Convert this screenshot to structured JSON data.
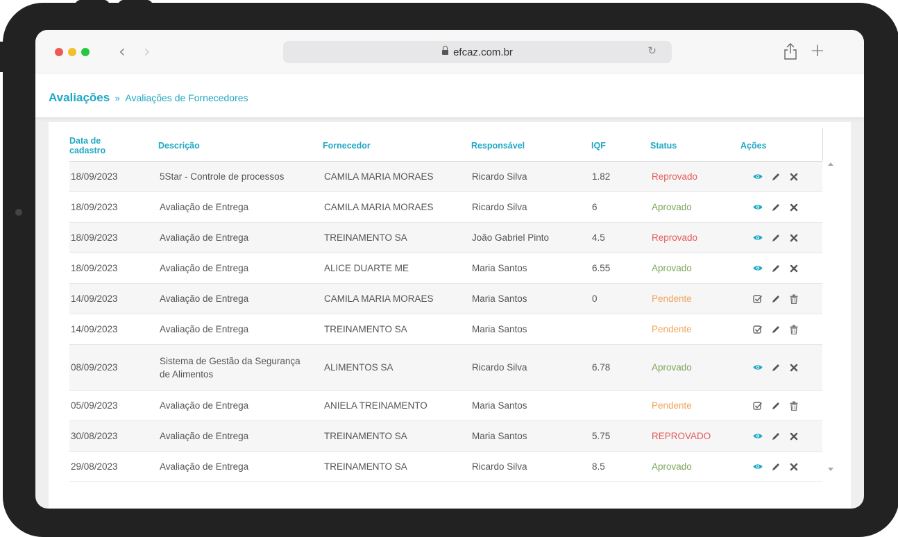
{
  "browser": {
    "url": "efcaz.com.br",
    "back_glyph": "‹",
    "forward_glyph": "›",
    "reload_glyph": "↻",
    "new_tab_glyph": "+"
  },
  "breadcrumb": {
    "main": "Avaliações",
    "separator": "»",
    "sub": "Avaliações de Fornecedores"
  },
  "table": {
    "headers": {
      "date": "Data de cadastro",
      "description": "Descrição",
      "supplier": "Fornecedor",
      "responsible": "Responsável",
      "iqf": "IQF",
      "status": "Status",
      "actions": "Ações"
    },
    "rows": [
      {
        "date": "18/09/2023",
        "description": "5Star - Controle de processos",
        "supplier": "CAMILA MARIA MORAES",
        "responsible": "Ricardo Silva",
        "iqf": "1.82",
        "status": "Reprovado",
        "status_kind": "reprovado",
        "actions": [
          "view",
          "edit",
          "delete-x"
        ]
      },
      {
        "date": "18/09/2023",
        "description": "Avaliação de Entrega",
        "supplier": "CAMILA MARIA MORAES",
        "responsible": "Ricardo Silva",
        "iqf": "6",
        "status": "Aprovado",
        "status_kind": "aprovado",
        "actions": [
          "view",
          "edit",
          "delete-x"
        ]
      },
      {
        "date": "18/09/2023",
        "description": "Avaliação de Entrega",
        "supplier": "TREINAMENTO SA",
        "responsible": "João Gabriel Pinto",
        "iqf": "4.5",
        "status": "Reprovado",
        "status_kind": "reprovado",
        "actions": [
          "view",
          "edit",
          "delete-x"
        ]
      },
      {
        "date": "18/09/2023",
        "description": "Avaliação de Entrega",
        "supplier": "ALICE DUARTE ME",
        "responsible": "Maria Santos",
        "iqf": "6.55",
        "status": "Aprovado",
        "status_kind": "aprovado",
        "actions": [
          "view",
          "edit",
          "delete-x"
        ]
      },
      {
        "date": "14/09/2023",
        "description": "Avaliação de Entrega",
        "supplier": "CAMILA MARIA MORAES",
        "responsible": "Maria Santos",
        "iqf": "0",
        "status": "Pendente",
        "status_kind": "pendente",
        "actions": [
          "evaluate",
          "edit",
          "trash"
        ]
      },
      {
        "date": "14/09/2023",
        "description": "Avaliação de Entrega",
        "supplier": "TREINAMENTO SA",
        "responsible": "Maria Santos",
        "iqf": "",
        "status": "Pendente",
        "status_kind": "pendente",
        "actions": [
          "evaluate",
          "edit",
          "trash"
        ]
      },
      {
        "date": "08/09/2023",
        "description": "Sistema de Gestão da Segurança de Alimentos",
        "supplier": "ALIMENTOS SA",
        "responsible": "Ricardo Silva",
        "iqf": "6.78",
        "status": "Aprovado",
        "status_kind": "aprovado",
        "actions": [
          "view",
          "edit",
          "delete-x"
        ]
      },
      {
        "date": "05/09/2023",
        "description": "Avaliação de Entrega",
        "supplier": "ANIELA TREINAMENTO",
        "responsible": "Maria Santos",
        "iqf": "",
        "status": "Pendente",
        "status_kind": "pendente",
        "actions": [
          "evaluate",
          "edit",
          "trash"
        ]
      },
      {
        "date": "30/08/2023",
        "description": "Avaliação de Entrega",
        "supplier": "TREINAMENTO SA",
        "responsible": "Maria Santos",
        "iqf": "5.75",
        "status": "REPROVADO",
        "status_kind": "reprovado",
        "actions": [
          "view",
          "edit",
          "delete-x"
        ]
      },
      {
        "date": "29/08/2023",
        "description": "Avaliação de Entrega",
        "supplier": "TREINAMENTO SA",
        "responsible": "Ricardo Silva",
        "iqf": "8.5",
        "status": "Aprovado",
        "status_kind": "aprovado",
        "actions": [
          "view",
          "edit",
          "delete-x"
        ]
      }
    ]
  },
  "colors": {
    "accent": "#1fa8c4",
    "aprovado": "#7ba65a",
    "reprovado": "#e45a5a",
    "pendente": "#f2a35a",
    "icon_view": "#1fa8c4",
    "icon_dark": "#555555"
  }
}
